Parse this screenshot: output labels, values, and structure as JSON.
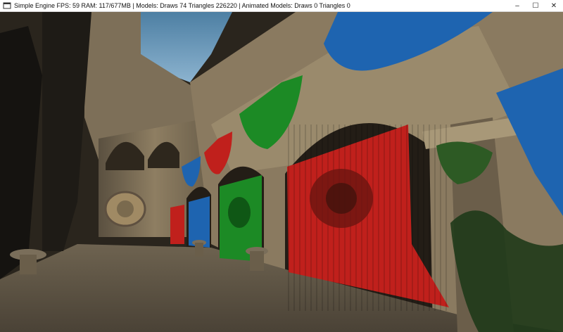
{
  "window": {
    "title": "Simple Engine FPS: 59 RAM: 117/677MB | Models: Draws 74 Triangles 226220 | Animated Models: Draws 0 Triangles 0",
    "icon": "app-window-icon",
    "controls": {
      "minimize": "–",
      "maximize": "☐",
      "close": "✕"
    }
  },
  "viewport": {
    "scene": "3d-render-atrium",
    "colors": {
      "sky": "#5f8fb0",
      "stone": "#8a7a60",
      "banner_red": "#c0201c",
      "banner_green": "#1c8a25",
      "banner_blue": "#1e64b0"
    }
  }
}
